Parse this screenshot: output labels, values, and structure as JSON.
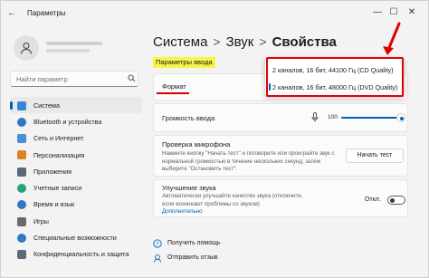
{
  "window": {
    "title": "Параметры",
    "controls": {
      "minimize": "—",
      "maximize": "☐",
      "close": "✕"
    }
  },
  "search": {
    "placeholder": "Найти параметр"
  },
  "sidebar": {
    "items": [
      {
        "label": "Система",
        "icon": "monitor-icon",
        "color": "#3a86d6",
        "active": true
      },
      {
        "label": "Bluetooth и устройства",
        "icon": "bluetooth-icon",
        "color": "#2f78c4"
      },
      {
        "label": "Сеть и Интернет",
        "icon": "network-icon",
        "color": "#4a8fd8"
      },
      {
        "label": "Персонализация",
        "icon": "brush-icon",
        "color": "#d9822b"
      },
      {
        "label": "Приложения",
        "icon": "apps-icon",
        "color": "#5a6a7a"
      },
      {
        "label": "Учетные записи",
        "icon": "account-icon",
        "color": "#2aa37a"
      },
      {
        "label": "Время и язык",
        "icon": "globe-icon",
        "color": "#2f78c4"
      },
      {
        "label": "Игры",
        "icon": "gamepad-icon",
        "color": "#6b6b6b"
      },
      {
        "label": "Специальные возможности",
        "icon": "accessibility-icon",
        "color": "#2f78c4"
      },
      {
        "label": "Конфиденциальность и защита",
        "icon": "shield-icon",
        "color": "#5a6a7a"
      }
    ]
  },
  "breadcrumb": {
    "part1": "Система",
    "part2": "Звук",
    "part3": "Свойства",
    "sep": ">"
  },
  "section": {
    "label": "Параметры ввода"
  },
  "format": {
    "label": "Формат",
    "options": [
      "2 каналов, 16 бит, 44100 Гц (CD Quality)",
      "2 каналов, 16 бит, 48000 Гц (DVD Quality)"
    ],
    "selected": 1
  },
  "volume": {
    "label": "Громкость ввода",
    "value": "100",
    "level": 1.0
  },
  "mic_test": {
    "title": "Проверка микрофона",
    "desc": "Нажмите кнопку \"Начать тест\" и поговорите или проиграйте звук с нормальной громкостью в течение нескольких секунд, затем выберите \"Остановить тест\".",
    "button": "Начать тест"
  },
  "enhance": {
    "title": "Улучшение звука",
    "desc": "Автоматически улучшайте качество звука (отключите, если возникают проблемы со звуком)",
    "link": "Дополнительно",
    "toggle_label": "Откл."
  },
  "links": {
    "help": "Получить помощь",
    "feedback": "Отправить отзыв"
  },
  "colors": {
    "accent": "#005fb8",
    "highlight": "#f7f54a",
    "annotation": "#e00000"
  }
}
